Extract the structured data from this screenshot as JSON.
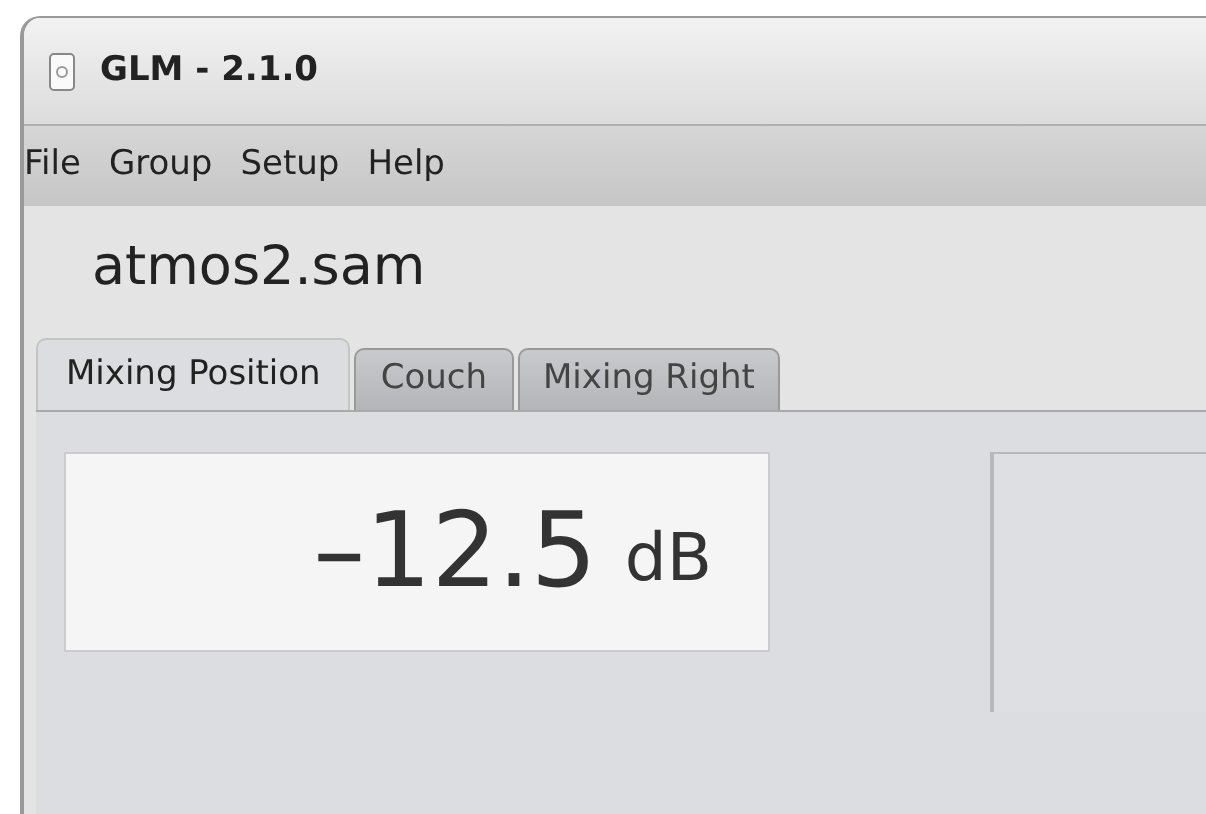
{
  "window": {
    "title": "GLM - 2.1.0"
  },
  "menu": [
    "File",
    "Group",
    "Setup",
    "Help"
  ],
  "file_name": "atmos2.sam",
  "tabs": [
    {
      "label": "Mixing Position",
      "selected": true
    },
    {
      "label": "Couch",
      "selected": false
    },
    {
      "label": "Mixing Right",
      "selected": false
    }
  ],
  "level_display": {
    "sign": "–",
    "value": "12.5",
    "unit": "dB"
  }
}
